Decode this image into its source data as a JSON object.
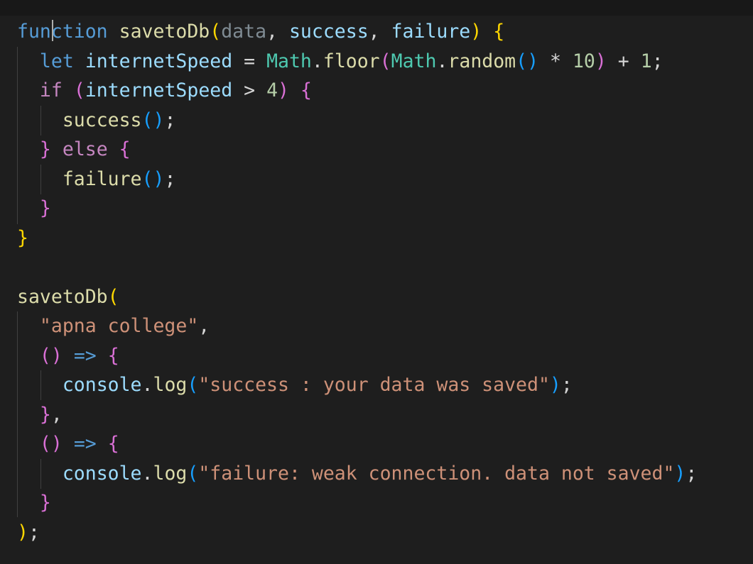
{
  "editor": {
    "colors": {
      "background": "#1e1e1e",
      "keyword": "#569cd6",
      "control_keyword": "#c586c0",
      "function": "#dcdcaa",
      "variable": "#9cdcfe",
      "class": "#4ec9b0",
      "number": "#b5cea8",
      "string": "#ce9178",
      "bracket_level_1": "#ffd700",
      "bracket_level_2": "#da70d6",
      "bracket_level_3": "#179fff"
    },
    "lines": [
      {
        "tokens": [
          {
            "t": "function",
            "c": "kw"
          },
          {
            "t": " "
          },
          {
            "t": "savetoDb",
            "c": "fn"
          },
          {
            "t": "(",
            "c": "b1"
          },
          {
            "t": "data",
            "c": "dim"
          },
          {
            "t": ", "
          },
          {
            "t": "success",
            "c": "var"
          },
          {
            "t": ", "
          },
          {
            "t": "failure",
            "c": "var"
          },
          {
            "t": ")",
            "c": "b1"
          },
          {
            "t": " "
          },
          {
            "t": "{",
            "c": "b1"
          }
        ]
      },
      {
        "tokens": [
          {
            "t": "  "
          },
          {
            "t": "let",
            "c": "kw"
          },
          {
            "t": " "
          },
          {
            "t": "internetSpeed",
            "c": "var"
          },
          {
            "t": " = "
          },
          {
            "t": "Math",
            "c": "cls"
          },
          {
            "t": "."
          },
          {
            "t": "floor",
            "c": "fn"
          },
          {
            "t": "(",
            "c": "b2"
          },
          {
            "t": "Math",
            "c": "cls"
          },
          {
            "t": "."
          },
          {
            "t": "random",
            "c": "fn"
          },
          {
            "t": "()",
            "c": "b3"
          },
          {
            "t": " * "
          },
          {
            "t": "10",
            "c": "num"
          },
          {
            "t": ")",
            "c": "b2"
          },
          {
            "t": " + "
          },
          {
            "t": "1",
            "c": "num"
          },
          {
            "t": ";"
          }
        ]
      },
      {
        "tokens": [
          {
            "t": "  "
          },
          {
            "t": "if",
            "c": "kw2"
          },
          {
            "t": " "
          },
          {
            "t": "(",
            "c": "b2"
          },
          {
            "t": "internetSpeed",
            "c": "var"
          },
          {
            "t": " > "
          },
          {
            "t": "4",
            "c": "num"
          },
          {
            "t": ")",
            "c": "b2"
          },
          {
            "t": " "
          },
          {
            "t": "{",
            "c": "b2"
          }
        ]
      },
      {
        "tokens": [
          {
            "t": "    "
          },
          {
            "t": "success",
            "c": "fn"
          },
          {
            "t": "()",
            "c": "b3"
          },
          {
            "t": ";"
          }
        ]
      },
      {
        "tokens": [
          {
            "t": "  "
          },
          {
            "t": "}",
            "c": "b2"
          },
          {
            "t": " "
          },
          {
            "t": "else",
            "c": "kw2"
          },
          {
            "t": " "
          },
          {
            "t": "{",
            "c": "b2"
          }
        ]
      },
      {
        "tokens": [
          {
            "t": "    "
          },
          {
            "t": "failure",
            "c": "fn"
          },
          {
            "t": "()",
            "c": "b3"
          },
          {
            "t": ";"
          }
        ]
      },
      {
        "tokens": [
          {
            "t": "  "
          },
          {
            "t": "}",
            "c": "b2"
          }
        ]
      },
      {
        "tokens": [
          {
            "t": "}",
            "c": "b1"
          }
        ]
      },
      {
        "tokens": []
      },
      {
        "tokens": [
          {
            "t": "savetoDb",
            "c": "fn"
          },
          {
            "t": "(",
            "c": "b1"
          }
        ]
      },
      {
        "tokens": [
          {
            "t": "  "
          },
          {
            "t": "\"apna college\"",
            "c": "str"
          },
          {
            "t": ","
          }
        ]
      },
      {
        "tokens": [
          {
            "t": "  "
          },
          {
            "t": "()",
            "c": "b2"
          },
          {
            "t": " "
          },
          {
            "t": "=>",
            "c": "kw"
          },
          {
            "t": " "
          },
          {
            "t": "{",
            "c": "b2"
          }
        ]
      },
      {
        "tokens": [
          {
            "t": "    "
          },
          {
            "t": "console",
            "c": "var"
          },
          {
            "t": "."
          },
          {
            "t": "log",
            "c": "fn"
          },
          {
            "t": "(",
            "c": "b3"
          },
          {
            "t": "\"success : your data was saved\"",
            "c": "str"
          },
          {
            "t": ")",
            "c": "b3"
          },
          {
            "t": ";"
          }
        ]
      },
      {
        "tokens": [
          {
            "t": "  "
          },
          {
            "t": "}",
            "c": "b2"
          },
          {
            "t": ","
          }
        ]
      },
      {
        "tokens": [
          {
            "t": "  "
          },
          {
            "t": "()",
            "c": "b2"
          },
          {
            "t": " "
          },
          {
            "t": "=>",
            "c": "kw"
          },
          {
            "t": " "
          },
          {
            "t": "{",
            "c": "b2"
          }
        ]
      },
      {
        "tokens": [
          {
            "t": "    "
          },
          {
            "t": "console",
            "c": "var"
          },
          {
            "t": "."
          },
          {
            "t": "log",
            "c": "fn"
          },
          {
            "t": "(",
            "c": "b3"
          },
          {
            "t": "\"failure: weak connection. data not saved\"",
            "c": "str"
          },
          {
            "t": ")",
            "c": "b3"
          },
          {
            "t": ";"
          }
        ]
      },
      {
        "tokens": [
          {
            "t": "  "
          },
          {
            "t": "}",
            "c": "b2"
          }
        ]
      },
      {
        "tokens": [
          {
            "t": ")",
            "c": "b1"
          },
          {
            "t": ";"
          }
        ]
      }
    ]
  }
}
